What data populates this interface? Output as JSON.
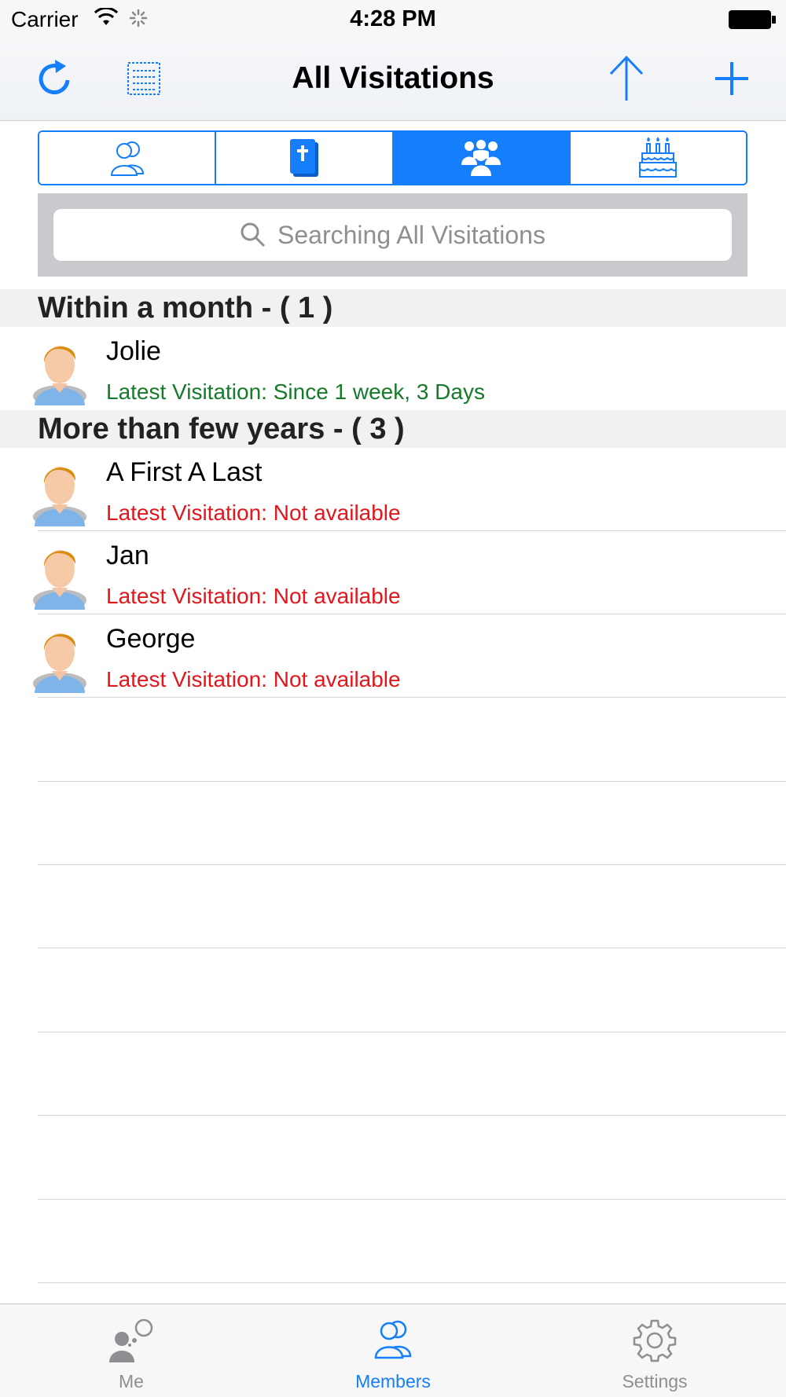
{
  "status_bar": {
    "carrier": "Carrier",
    "time": "4:28 PM"
  },
  "nav": {
    "title": "All Visitations"
  },
  "segments": [
    {
      "icon": "members-icon",
      "active": false
    },
    {
      "icon": "bible-icon",
      "active": false
    },
    {
      "icon": "group-visitations-icon",
      "active": true
    },
    {
      "icon": "birthday-cake-icon",
      "active": false
    }
  ],
  "search": {
    "placeholder": "Searching All Visitations"
  },
  "sections": [
    {
      "header": "Within a month - ( 1 )",
      "rows": [
        {
          "name": "Jolie",
          "status": "Latest Visitation: Since 1 week, 3 Days",
          "status_color": "#157a2a"
        }
      ]
    },
    {
      "header": "More than few years - ( 3 )",
      "rows": [
        {
          "name": "A First A Last",
          "status": "Latest Visitation: Not available",
          "status_color": "#e3161c"
        },
        {
          "name": "Jan",
          "status": "Latest Visitation: Not available",
          "status_color": "#e3161c"
        },
        {
          "name": "George",
          "status": "Latest Visitation: Not available",
          "status_color": "#e3161c"
        }
      ]
    }
  ],
  "tabs": [
    {
      "label": "Me",
      "icon": "me-icon",
      "active": false
    },
    {
      "label": "Members",
      "icon": "members-tab-icon",
      "active": true
    },
    {
      "label": "Settings",
      "icon": "gear-icon",
      "active": false
    }
  ],
  "colors": {
    "accent": "#147efb",
    "recent": "#157a2a",
    "unavailable": "#e3161c"
  }
}
